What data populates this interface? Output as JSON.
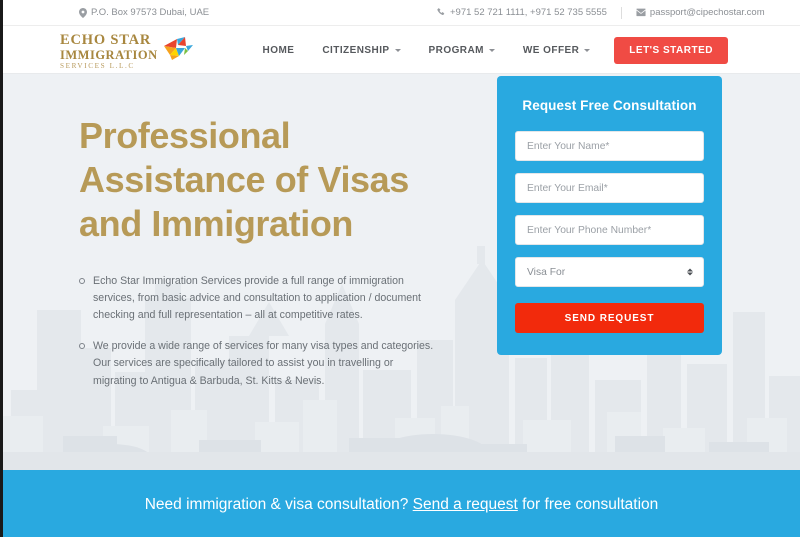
{
  "topbar": {
    "address_icon": "map-pin-icon",
    "address": "P.O. Box 97573 Dubai, UAE",
    "phone_icon": "phone-icon",
    "phones": "+971 52 721 1111,  +971 52 735 5555",
    "email_icon": "envelope-icon",
    "email": "passport@cipechostar.com"
  },
  "header": {
    "logo": {
      "line1": "ECHO STAR",
      "line2": "IMMIGRATION",
      "line3": "SERVICES L.L.C",
      "mark_icon": "origami-bird-logo-icon"
    },
    "nav": [
      {
        "label": "HOME",
        "has_dropdown": false
      },
      {
        "label": "CITIZENSHIP",
        "has_dropdown": true
      },
      {
        "label": "PROGRAM",
        "has_dropdown": true
      },
      {
        "label": "WE OFFER",
        "has_dropdown": true
      }
    ],
    "cta_label": "LET'S STARTED"
  },
  "hero": {
    "title": "Professional Assistance of Visas and Immigration",
    "bullets": [
      "Echo Star Immigration Services provide a full range of immigration services, from basic advice and consultation to application / document checking and full representation – all at competitive rates.",
      "We provide a wide range of services for many visa types and categories. Our services are specifically tailored to assist you in travelling or migrating to Antigua & Barbuda, St. Kitts & Nevis."
    ]
  },
  "form": {
    "title": "Request Free Consultation",
    "name_placeholder": "Enter Your Name*",
    "name_value": "",
    "email_placeholder": "Enter Your Email*",
    "email_value": "",
    "phone_placeholder": "Enter Your Phone Number*",
    "phone_value": "",
    "visa_selected": "Visa For",
    "visa_options": [
      "Visa For"
    ],
    "submit_label": "SEND REQUEST"
  },
  "cta_bar": {
    "text_before": "Need immigration & visa consultation? ",
    "link_label": "Send a request",
    "text_after": " for free consultation"
  },
  "colors": {
    "brand_blue": "#29a9e0",
    "brand_gold": "#b79a57",
    "cta_red": "#f04b44",
    "submit_red": "#f22a0c",
    "hero_bg": "#eef1f4"
  }
}
